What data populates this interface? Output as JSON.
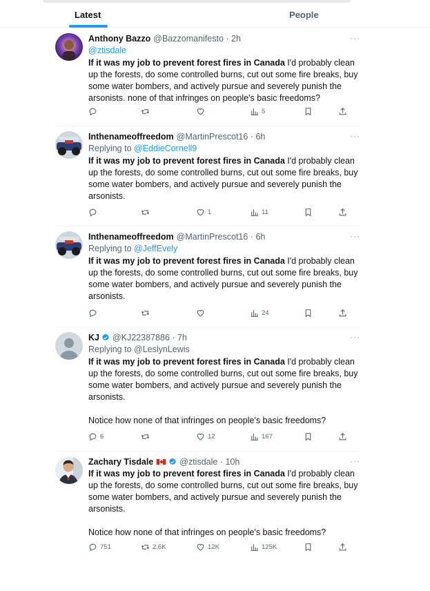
{
  "tabs": [
    {
      "label": "Latest"
    },
    {
      "label": "People"
    }
  ],
  "tweets": [
    {
      "name": "Anthony Bazzo",
      "handle": "@Bazzomanifesto · 2h",
      "mention_line": "@ztisdale",
      "text_bold": "If it was my job to prevent forest fires in Canada",
      "text": " I'd probably clean up the forests, do some controlled burns, cut out some fire breaks, buy some water bombers, and actively pursue and severely punish the arsonists.  none of that infringes on people's basic freedoms?",
      "replies": "",
      "retweets": "",
      "likes": "",
      "views": "5"
    },
    {
      "name": "Inthenameoffreedom",
      "handle": "@MartinPrescot16 · 6h",
      "replying_prefix": "Replying to ",
      "replying_to": "@EddieCornell9",
      "text_bold": "If it was my job to prevent forest fires in Canada",
      "text": " I'd probably clean up the forests, do some controlled burns, cut out some fire breaks, buy some water bombers, and actively pursue and severely punish the arsonists.",
      "replies": "",
      "retweets": "",
      "likes": "1",
      "views": "11"
    },
    {
      "name": "Inthenameoffreedom",
      "handle": "@MartinPrescot16 · 6h",
      "replying_prefix": "Replying to ",
      "replying_to": "@JeffEvely",
      "text_bold": "If it was my job to prevent forest fires in Canada",
      "text": " I'd probably clean up the forests, do some controlled burns, cut out some fire breaks, buy some water bombers, and actively pursue and severely punish the arsonists.",
      "replies": "",
      "retweets": "",
      "likes": "",
      "views": "24"
    },
    {
      "name": "KJ",
      "handle": "@KJ22387886 · 7h",
      "replying_line": "Replying to @LeslynLewis",
      "text_bold": "If it was my job to prevent forest fires in Canada",
      "text": " I'd probably clean up the forests, do some controlled burns, cut out some fire breaks, buy some water bombers, and actively pursue and severely punish the arsonists.",
      "text2": "Notice how none of that infringes on people's basic freedoms?",
      "replies": "6",
      "retweets": "",
      "likes": "12",
      "views": "167"
    },
    {
      "name": "Zachary Tisdale",
      "handle": "@ztisdale · 10h",
      "text_bold": "If it was my job to prevent forest fires in Canada",
      "text": " I'd probably clean up the forests, do some controlled burns, cut out some fire breaks, buy some water bombers, and actively pursue and severely punish the arsonists.",
      "text2": "Notice how none of that infringes on people's basic freedoms?",
      "replies": "751",
      "retweets": "2.6K",
      "likes": "12K",
      "views": "125K"
    }
  ],
  "icons": {
    "more": "more-horizontal-icon",
    "reply": "reply-icon",
    "retweet": "retweet-icon",
    "like": "heart-icon",
    "views": "views-chart-icon",
    "bookmark": "bookmark-icon",
    "share": "share-icon",
    "verified": "verified-badge-icon",
    "flag": "canada-flag-icon"
  },
  "colors": {
    "accent": "#1d9bf0",
    "text": "#0f1419",
    "secondary": "#536471"
  }
}
